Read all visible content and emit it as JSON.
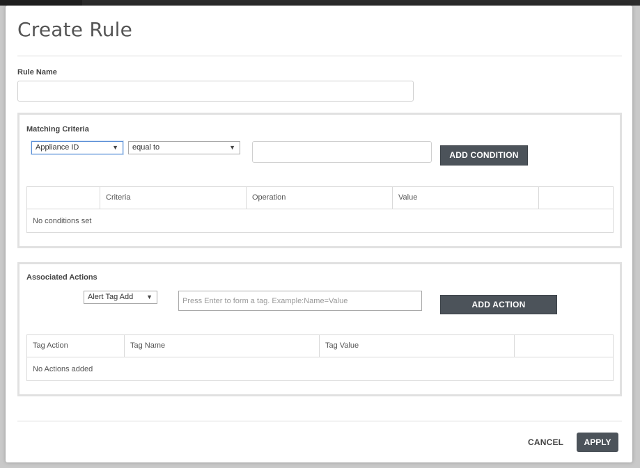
{
  "modal": {
    "title": "Create Rule"
  },
  "rule_name": {
    "label": "Rule Name",
    "value": "",
    "placeholder": ""
  },
  "matching_criteria": {
    "title": "Matching Criteria",
    "criteria_select": {
      "selected": "Appliance ID",
      "arrow": "▼"
    },
    "operation_select": {
      "selected": "equal to",
      "arrow": "▼"
    },
    "value_input": {
      "value": "",
      "placeholder": ""
    },
    "add_button_label": "ADD CONDITION",
    "table": {
      "columns": [
        "",
        "Criteria",
        "Operation",
        "Value",
        ""
      ],
      "empty_text": "No conditions set"
    }
  },
  "associated_actions": {
    "title": "Associated Actions",
    "action_select": {
      "selected": "Alert Tag Add",
      "arrow": "▼"
    },
    "tag_input": {
      "value": "",
      "placeholder": "Press Enter to form a tag. Example:Name=Value"
    },
    "add_button_label": "ADD ACTION",
    "table": {
      "columns": [
        "Tag Action",
        "Tag Name",
        "Tag Value",
        ""
      ],
      "empty_text": "No Actions added"
    }
  },
  "footer": {
    "cancel_label": "CANCEL",
    "apply_label": "APPLY"
  },
  "colors": {
    "button_dark": "#4c535a",
    "panel_border": "#e1e1e1",
    "focus_border": "#5b8fd6"
  }
}
